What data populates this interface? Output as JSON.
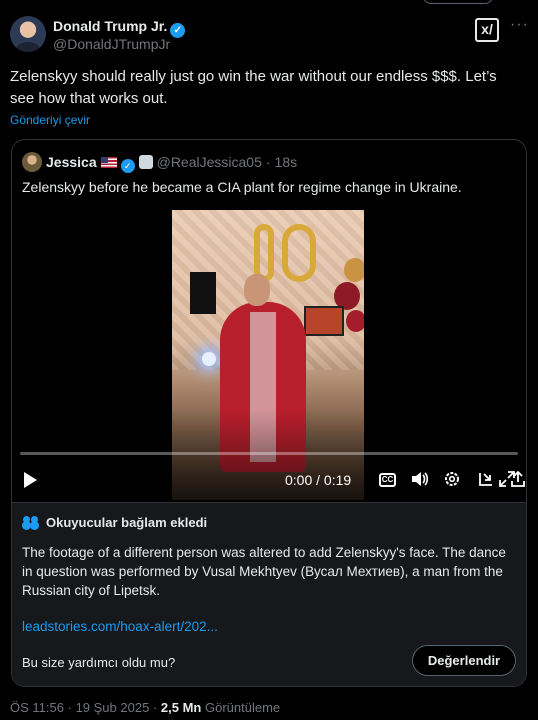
{
  "author": {
    "name": "Donald Trump Jr.",
    "handle": "@DonaldJTrumpJr"
  },
  "toolbar": {
    "grok_icon": "grok-icon",
    "more_icon": "more-icon",
    "grok_glyph": "x/",
    "more_glyph": "···"
  },
  "tweet": {
    "text": "Zelenskyy should really just go win the war without our endless $$$. Let’s see how that works out.",
    "translate": "Gönderiyi çevir"
  },
  "quote": {
    "name": "Jessica",
    "handle": "@RealJessica05",
    "sep": "·",
    "time": "18s",
    "text": "Zelenskyy before he became a CIA plant for regime change in Ukraine."
  },
  "video": {
    "time": "0:00 / 0:19",
    "progress": 0,
    "cc_label": "CC",
    "icons": [
      "play-icon",
      "captions-icon",
      "volume-icon",
      "settings-icon",
      "pip-icon",
      "share-icon",
      "fullscreen-icon"
    ]
  },
  "community_note": {
    "heading": "Okuyucular bağlam ekledi",
    "body": "The footage of a different person was altered to add Zelenskyy's face. The dance in question was performed by Vusal Mekhtyev (Вусал Мехтиев), a man from the Russian city of Lipetsk.",
    "link": "leadstories.com/hoax-alert/202...",
    "helpful_question": "Bu size yardımcı oldu mu?",
    "rate_button": "Değerlendir"
  },
  "meta": {
    "time": "ÖS 11:56",
    "sep1": "·",
    "date": "19 Şub 2025",
    "sep2": "·",
    "views": "2,5 Mn",
    "views_label": "Görüntüleme"
  },
  "colors": {
    "background": "#000000",
    "accent": "#1d9bf0",
    "text": "#e7e9ea",
    "muted": "#71767b",
    "border": "#2f3336"
  }
}
